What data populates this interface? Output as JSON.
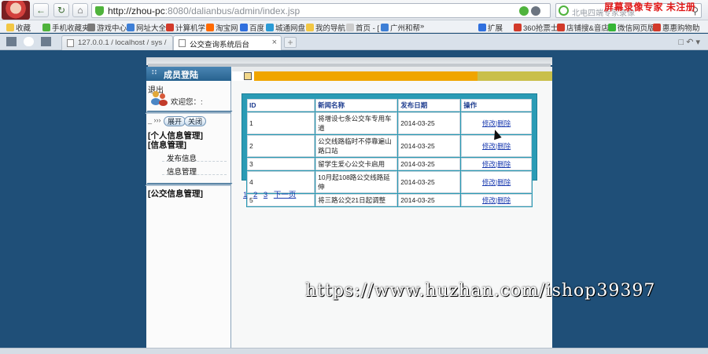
{
  "browser": {
    "url_host": "http://zhou-pc",
    "url_path": ":8080/dalianbus/admin/index.jsp",
    "search_placeholder": "北电四端专家录像",
    "recorder_watermark": "屏幕录像专家  未注册",
    "favorites": [
      "收藏",
      "手机收藏夹",
      "游戏中心",
      "网址大全",
      "计算机学",
      "淘宝网",
      "百度",
      "城通网盘",
      "我的导航",
      "首页 - [",
      "广州和帮",
      "»",
      "扩展",
      "360抢票士",
      "店铺搜&音店",
      "微信网页版",
      "惠惠购物助"
    ],
    "tabs": [
      {
        "label": "127.0.0.1 / localhost / sys /",
        "active": false
      },
      {
        "label": "公交查询系统后台",
        "active": true
      }
    ],
    "colors": {
      "page_bg": "#1f4f78",
      "accent": "#f0a500",
      "grid_border": "#2a9bb5",
      "link": "#1b3bb0"
    }
  },
  "sidebar": {
    "title": "成员登陆",
    "exit_text": "退出",
    "welcome": "欢迎您：:",
    "expand_label": "展开",
    "collapse_label": "关闭",
    "sections": [
      {
        "label": "[个人信息管理]"
      },
      {
        "label": "[信息管理]",
        "items": [
          "发布信息",
          "信息管理"
        ]
      },
      {
        "label": "[公交信息管理]"
      }
    ]
  },
  "news_table": {
    "headers": [
      "ID",
      "新闻名称",
      "发布日期",
      "操作"
    ],
    "rows": [
      {
        "id": "1",
        "title": "将增设七条公交车专用车道",
        "date": "2014-03-25",
        "action": "修改|删除"
      },
      {
        "id": "2",
        "title": "公交线路临时不停靠遍山路口站",
        "date": "2014-03-25",
        "action": "修改|删除"
      },
      {
        "id": "3",
        "title": "留学生爱心公交卡启用",
        "date": "2014-03-25",
        "action": "修改|删除"
      },
      {
        "id": "4",
        "title": "10月起108路公交线路延伸",
        "date": "2014-03-25",
        "action": "修改|删除"
      },
      {
        "id": "5",
        "title": "将三路公交21日起调整",
        "date": "2014-03-25",
        "action": "修改|删除"
      }
    ]
  },
  "pagination": {
    "pages": [
      "1",
      "2",
      "3"
    ],
    "next_label": "下一页"
  },
  "overlay_watermark": "https://www.huzhan.com/ishop39397"
}
